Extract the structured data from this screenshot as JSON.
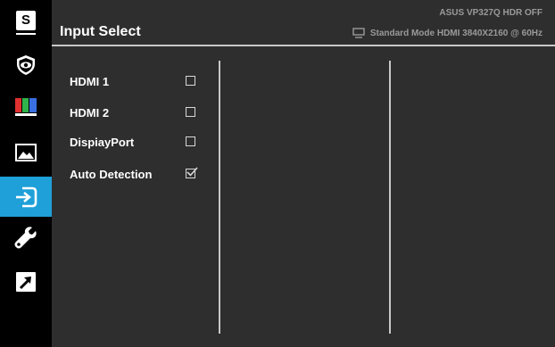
{
  "header": {
    "title": "Input Select",
    "model_line": "ASUS  VP327Q  HDR OFF",
    "status_line": "Standard Mode HDMI 3840X2160 @ 60Hz"
  },
  "sidebar": {
    "items": [
      {
        "icon": "splendid-s-icon",
        "label": "S",
        "active": false
      },
      {
        "icon": "eye-care-icon",
        "active": false
      },
      {
        "icon": "color-bars-icon",
        "active": false
      },
      {
        "icon": "image-icon",
        "active": false
      },
      {
        "icon": "input-select-icon",
        "active": true
      },
      {
        "icon": "wrench-icon",
        "active": false
      },
      {
        "icon": "shortcut-icon",
        "active": false
      }
    ]
  },
  "options": [
    {
      "label": "HDMI 1",
      "checked": false
    },
    {
      "label": "HDMI 2",
      "checked": false
    },
    {
      "label": "DispiayPort",
      "checked": false
    },
    {
      "label": "Auto Detection",
      "checked": true
    }
  ],
  "colors": {
    "accent": "#1fa0d8",
    "panel": "#2e2e2e",
    "sidebar": "#000000"
  }
}
